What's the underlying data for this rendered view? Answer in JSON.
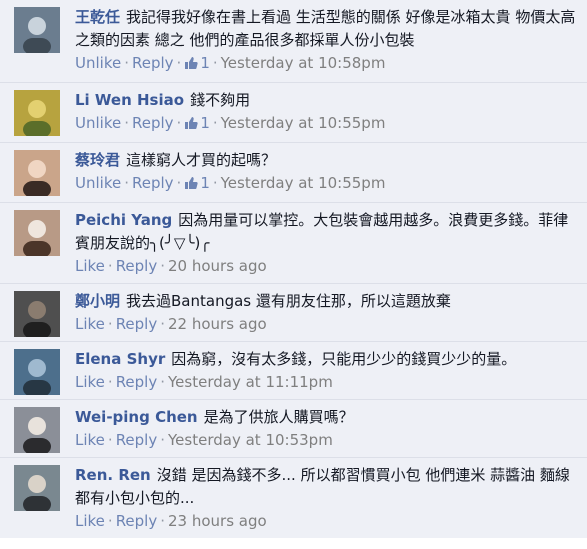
{
  "comments": [
    {
      "author": "王乾任",
      "text": "我記得我好像在書上看過 生活型態的關係 好像是冰箱太貴 物價太高 之類的因素 總之 他們的產品很多都採單人份小包裝",
      "actions": [
        "Unlike",
        "Reply"
      ],
      "likes": "1",
      "time": "Yesterday at 10:58pm",
      "avatar_colors": [
        "#6b7d8f",
        "#c9d3dc",
        "#3e4a55"
      ]
    },
    {
      "author": "Li Wen Hsiao",
      "text": "錢不夠用",
      "actions": [
        "Unlike",
        "Reply"
      ],
      "likes": "1",
      "time": "Yesterday at 10:55pm",
      "avatar_colors": [
        "#b7a33f",
        "#e3d070",
        "#5b6e2a"
      ]
    },
    {
      "author": "蔡玲君",
      "text": "這樣窮人才買的起嗎？",
      "actions": [
        "Unlike",
        "Reply"
      ],
      "likes": "1",
      "time": "Yesterday at 10:55pm",
      "avatar_colors": [
        "#caa58a",
        "#f0d6c3",
        "#3a2b25"
      ]
    },
    {
      "author": "Peichi Yang",
      "text": "因為用量可以掌控。大包裝會越用越多。浪費更多錢。菲律賓朋友說的╮(╯▽╰)╭",
      "actions": [
        "Like",
        "Reply"
      ],
      "likes": "",
      "time": "20 hours ago",
      "avatar_colors": [
        "#b89a86",
        "#efe6de",
        "#4b3529"
      ]
    },
    {
      "author": "鄭小明",
      "text": "我去過Bantangas 還有朋友住那，所以這題放棄",
      "actions": [
        "Like",
        "Reply"
      ],
      "likes": "",
      "time": "22 hours ago",
      "avatar_colors": [
        "#4f4f4f",
        "#8a7c6f",
        "#1f1f1f"
      ]
    },
    {
      "author": "Elena Shyr",
      "text": "因為窮，沒有太多錢，只能用少少的錢買少少的量。",
      "actions": [
        "Like",
        "Reply"
      ],
      "likes": "",
      "time": "Yesterday at 11:11pm",
      "avatar_colors": [
        "#4d6f8c",
        "#9fb9cf",
        "#273744"
      ]
    },
    {
      "author": "Wei-ping Chen",
      "text": "是為了供旅人購買嗎？",
      "actions": [
        "Like",
        "Reply"
      ],
      "likes": "",
      "time": "Yesterday at 10:53pm",
      "avatar_colors": [
        "#8b8f98",
        "#e8e2dc",
        "#2b2b2e"
      ]
    },
    {
      "author": "Ren. Ren",
      "text": "沒錯 是因為錢不多... 所以都習慣買小包 他們連米 蒜醬油 麵線 都有小包小包的...",
      "actions": [
        "Like",
        "Reply"
      ],
      "likes": "",
      "time": "23 hours ago",
      "avatar_colors": [
        "#7a8890",
        "#d9d2c8",
        "#2e3236"
      ]
    }
  ]
}
